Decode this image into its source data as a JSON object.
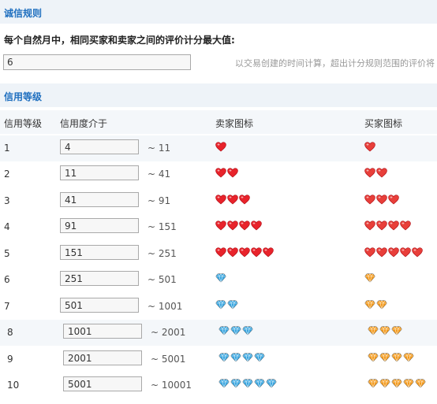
{
  "rule_section": {
    "title": "诚信规则",
    "label": "每个自然月中，相同买家和卖家之间的评价计分最大值:",
    "input_value": "6",
    "note": "以交易创建的时间计算，超出计分规则范围的评价将"
  },
  "level_section": {
    "title": "信用等级",
    "headers": [
      "信用等级",
      "信用度介于",
      "卖家图标",
      "买家图标"
    ],
    "rows": [
      {
        "level": "1",
        "from": "4",
        "to": "~ 11",
        "icon_type": "heart",
        "count": 1
      },
      {
        "level": "2",
        "from": "11",
        "to": "~ 41",
        "icon_type": "heart",
        "count": 2
      },
      {
        "level": "3",
        "from": "41",
        "to": "~ 91",
        "icon_type": "heart",
        "count": 3
      },
      {
        "level": "4",
        "from": "91",
        "to": "~ 151",
        "icon_type": "heart",
        "count": 4
      },
      {
        "level": "5",
        "from": "151",
        "to": "~ 251",
        "icon_type": "heart",
        "count": 5
      },
      {
        "level": "6",
        "from": "251",
        "to": "~ 501",
        "icon_type": "diamond",
        "count": 1
      },
      {
        "level": "7",
        "from": "501",
        "to": "~ 1001",
        "icon_type": "diamond",
        "count": 2
      },
      {
        "level": "8",
        "from": "1001",
        "to": "~ 2001",
        "icon_type": "diamond",
        "count": 3
      },
      {
        "level": "9",
        "from": "2001",
        "to": "~ 5001",
        "icon_type": "diamond",
        "count": 4
      },
      {
        "level": "10",
        "from": "5001",
        "to": "~ 10001",
        "icon_type": "diamond",
        "count": 5
      }
    ]
  },
  "colors": {
    "accent": "#1f6fbf",
    "section_bg": "#eef3f8",
    "seller_heart": "#e8232b",
    "buyer_heart": "#e83f3a",
    "seller_diamond": "#3aa6e0",
    "buyer_diamond": "#f39a1c"
  },
  "icons": {
    "seller_heart": "red-heart-icon",
    "buyer_heart": "red-heart-buyer-icon",
    "seller_diamond": "blue-diamond-icon",
    "buyer_diamond": "orange-diamond-icon"
  }
}
